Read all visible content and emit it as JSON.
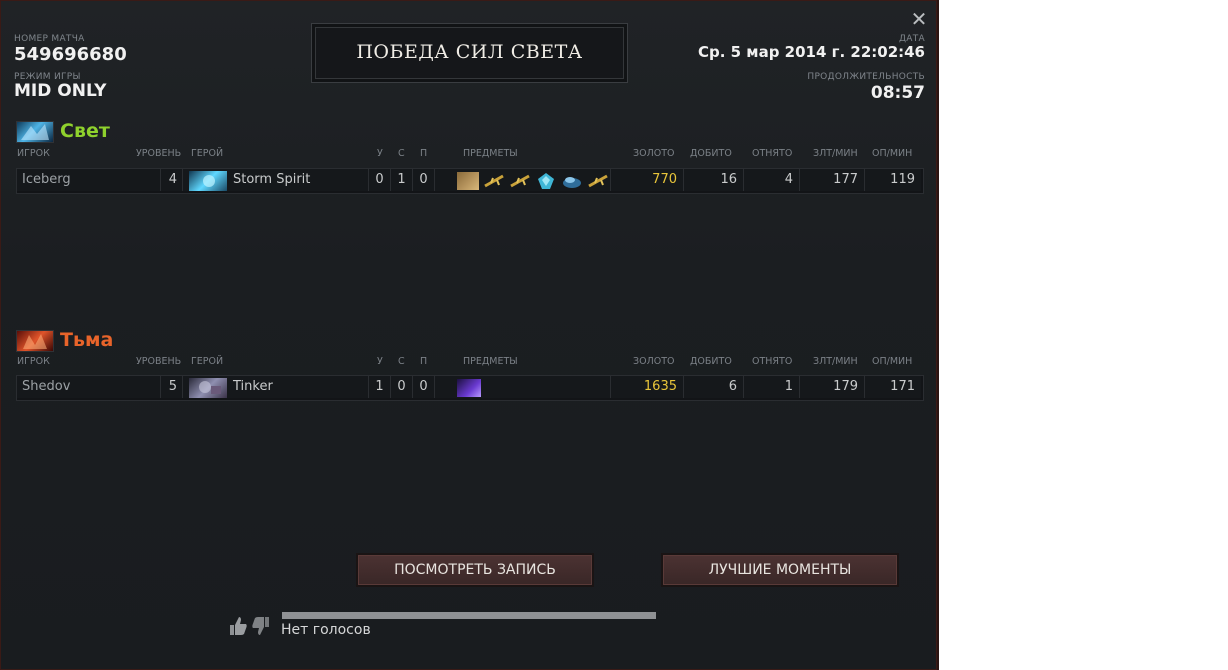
{
  "header": {
    "match_label": "НОМЕР МАТЧА",
    "match_id": "549696680",
    "mode_label": "РЕЖИМ ИГРЫ",
    "mode": "MID ONLY",
    "banner": "ПОБЕДА СИЛ СВЕТА",
    "date_label": "ДАТА",
    "date": "Ср. 5 мар 2014 г. 22:02:46",
    "duration_label": "ПРОДОЛЖИТЕЛЬНОСТЬ",
    "duration": "08:57",
    "close_icon": "close-icon"
  },
  "columns": {
    "player": "ИГРОК",
    "level": "УРОВЕНЬ",
    "hero": "ГЕРОЙ",
    "kills": "У",
    "deaths": "С",
    "assists": "П",
    "items": "ПРЕДМЕТЫ",
    "gold": "ЗОЛОТО",
    "last_hits": "ДОБИТО",
    "denies": "ОТНЯТО",
    "gpm": "ЗЛТ/МИН",
    "xpm": "ОП/МИН"
  },
  "radiant": {
    "title": "Свет",
    "color": "#8fd12d",
    "players": [
      {
        "name": "Iceberg",
        "level": "4",
        "hero": "Storm Spirit",
        "kills": "0",
        "deaths": "1",
        "assists": "0",
        "gold": "770",
        "last_hits": "16",
        "denies": "4",
        "gpm": "177",
        "xpm": "119",
        "items": [
          "scroll-icon",
          "branch-icon",
          "branch-icon",
          "gem-icon",
          "boots-icon",
          "branch-icon"
        ]
      }
    ]
  },
  "dire": {
    "title": "Тьма",
    "color": "#e8642a",
    "players": [
      {
        "name": "Shedov",
        "level": "5",
        "hero": "Tinker",
        "kills": "1",
        "deaths": "0",
        "assists": "0",
        "gold": "1635",
        "last_hits": "6",
        "denies": "1",
        "gpm": "179",
        "xpm": "171",
        "items": [
          "bottle-icon"
        ]
      }
    ]
  },
  "gold_color": "#e8c53a",
  "buttons": {
    "watch_replay": "ПОСМОТРЕТЬ ЗАПИСЬ",
    "highlights": "ЛУЧШИЕ МОМЕНТЫ"
  },
  "votes": {
    "text": "Нет голосов",
    "up_icon": "thumbs-up-icon",
    "down_icon": "thumbs-down-icon"
  }
}
